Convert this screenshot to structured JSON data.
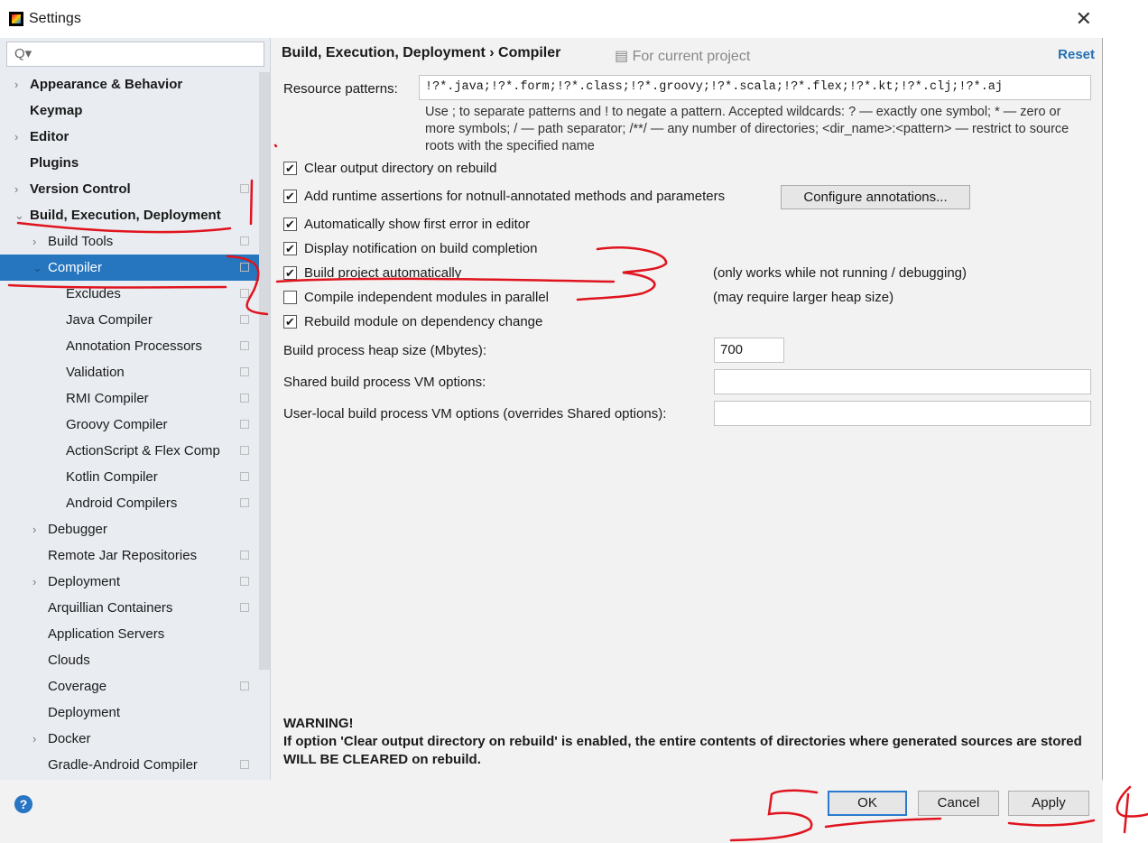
{
  "window": {
    "title": "Settings",
    "close_glyph": "✕"
  },
  "sidebar": {
    "search_placeholder": "Q▾",
    "items": [
      {
        "label": "Appearance & Behavior",
        "level": 0,
        "bold": true,
        "arrow": "›"
      },
      {
        "label": "Keymap",
        "level": 0,
        "bold": true,
        "arrow": ""
      },
      {
        "label": "Editor",
        "level": 0,
        "bold": true,
        "arrow": "›"
      },
      {
        "label": "Plugins",
        "level": 0,
        "bold": true,
        "arrow": ""
      },
      {
        "label": "Version Control",
        "level": 0,
        "bold": true,
        "arrow": "›",
        "proj": true
      },
      {
        "label": "Build, Execution, Deployment",
        "level": 0,
        "bold": true,
        "arrow": "⌄"
      },
      {
        "label": "Build Tools",
        "level": 1,
        "arrow": "›",
        "proj": true
      },
      {
        "label": "Compiler",
        "level": 1,
        "arrow": "⌄",
        "proj": true,
        "selected": true
      },
      {
        "label": "Excludes",
        "level": 2,
        "proj": true
      },
      {
        "label": "Java Compiler",
        "level": 2,
        "proj": true
      },
      {
        "label": "Annotation Processors",
        "level": 2,
        "proj": true
      },
      {
        "label": "Validation",
        "level": 2,
        "proj": true
      },
      {
        "label": "RMI Compiler",
        "level": 2,
        "proj": true
      },
      {
        "label": "Groovy Compiler",
        "level": 2,
        "proj": true
      },
      {
        "label": "ActionScript & Flex Comp",
        "level": 2,
        "proj": true
      },
      {
        "label": "Kotlin Compiler",
        "level": 2,
        "proj": true
      },
      {
        "label": "Android Compilers",
        "level": 2,
        "proj": true
      },
      {
        "label": "Debugger",
        "level": 1,
        "arrow": "›"
      },
      {
        "label": "Remote Jar Repositories",
        "level": 1,
        "proj": true
      },
      {
        "label": "Deployment",
        "level": 1,
        "arrow": "›",
        "proj": true
      },
      {
        "label": "Arquillian Containers",
        "level": 1,
        "proj": true
      },
      {
        "label": "Application Servers",
        "level": 1
      },
      {
        "label": "Clouds",
        "level": 1
      },
      {
        "label": "Coverage",
        "level": 1,
        "proj": true
      },
      {
        "label": "Deployment",
        "level": 1
      },
      {
        "label": "Docker",
        "level": 1,
        "arrow": "›"
      },
      {
        "label": "Gradle-Android Compiler",
        "level": 1,
        "proj": true
      }
    ]
  },
  "main": {
    "breadcrumb": "Build, Execution, Deployment  ›  Compiler",
    "for_project": "▤ For current project",
    "reset": "Reset",
    "resource_label": "Resource patterns:",
    "resource_value": "!?*.java;!?*.form;!?*.class;!?*.groovy;!?*.scala;!?*.flex;!?*.kt;!?*.clj;!?*.aj",
    "help": "Use ; to separate patterns and ! to negate a pattern. Accepted wildcards: ? — exactly one symbol; * — zero or more symbols; / — path separator; /**/ — any number of directories; <dir_name>:<pattern> — restrict to source roots with the specified name",
    "checkboxes": [
      {
        "label": "Clear output directory on rebuild",
        "checked": true
      },
      {
        "label": "Add runtime assertions for notnull-annotated methods and parameters",
        "checked": true
      },
      {
        "label": "Automatically show first error in editor",
        "checked": true
      },
      {
        "label": "Display notification on build completion",
        "checked": true
      },
      {
        "label": "Build project automatically",
        "checked": true,
        "note": "(only works while not running / debugging)"
      },
      {
        "label": "Compile independent modules in parallel",
        "checked": false,
        "note": "(may require larger heap size)"
      },
      {
        "label": "Rebuild module on dependency change",
        "checked": true
      }
    ],
    "configure_btn": "Configure annotations...",
    "heap_label": "Build process heap size (Mbytes):",
    "heap_value": "700",
    "shared_label": "Shared build process VM options:",
    "shared_value": "",
    "local_label": "User-local build process VM options (overrides Shared options):",
    "local_value": "",
    "warning_title": "WARNING!",
    "warning_text": "If option 'Clear output directory on rebuild' is enabled, the entire contents of directories where generated sources are stored WILL BE CLEARED on rebuild."
  },
  "buttons": {
    "help": "?",
    "ok": "OK",
    "cancel": "Cancel",
    "apply": "Apply"
  },
  "colors": {
    "selection": "#2675bf",
    "link": "#2470b3",
    "annotation": "#e0141e"
  }
}
